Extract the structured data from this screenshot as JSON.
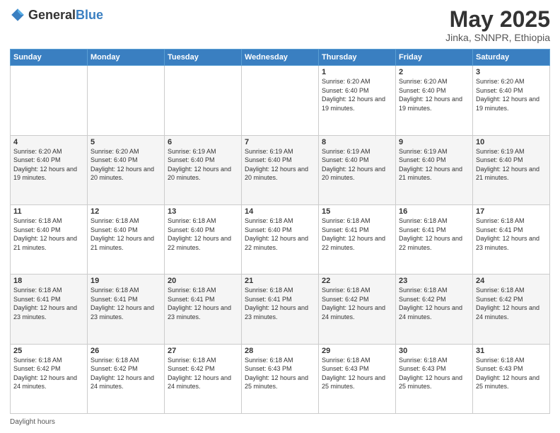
{
  "header": {
    "logo_general": "General",
    "logo_blue": "Blue",
    "month_title": "May 2025",
    "location": "Jinka, SNNPR, Ethiopia"
  },
  "days_of_week": [
    "Sunday",
    "Monday",
    "Tuesday",
    "Wednesday",
    "Thursday",
    "Friday",
    "Saturday"
  ],
  "footer_label": "Daylight hours",
  "weeks": [
    [
      {
        "day": "",
        "sunrise": "",
        "sunset": "",
        "daylight": ""
      },
      {
        "day": "",
        "sunrise": "",
        "sunset": "",
        "daylight": ""
      },
      {
        "day": "",
        "sunrise": "",
        "sunset": "",
        "daylight": ""
      },
      {
        "day": "",
        "sunrise": "",
        "sunset": "",
        "daylight": ""
      },
      {
        "day": "1",
        "sunrise": "Sunrise: 6:20 AM",
        "sunset": "Sunset: 6:40 PM",
        "daylight": "Daylight: 12 hours and 19 minutes."
      },
      {
        "day": "2",
        "sunrise": "Sunrise: 6:20 AM",
        "sunset": "Sunset: 6:40 PM",
        "daylight": "Daylight: 12 hours and 19 minutes."
      },
      {
        "day": "3",
        "sunrise": "Sunrise: 6:20 AM",
        "sunset": "Sunset: 6:40 PM",
        "daylight": "Daylight: 12 hours and 19 minutes."
      }
    ],
    [
      {
        "day": "4",
        "sunrise": "Sunrise: 6:20 AM",
        "sunset": "Sunset: 6:40 PM",
        "daylight": "Daylight: 12 hours and 19 minutes."
      },
      {
        "day": "5",
        "sunrise": "Sunrise: 6:20 AM",
        "sunset": "Sunset: 6:40 PM",
        "daylight": "Daylight: 12 hours and 20 minutes."
      },
      {
        "day": "6",
        "sunrise": "Sunrise: 6:19 AM",
        "sunset": "Sunset: 6:40 PM",
        "daylight": "Daylight: 12 hours and 20 minutes."
      },
      {
        "day": "7",
        "sunrise": "Sunrise: 6:19 AM",
        "sunset": "Sunset: 6:40 PM",
        "daylight": "Daylight: 12 hours and 20 minutes."
      },
      {
        "day": "8",
        "sunrise": "Sunrise: 6:19 AM",
        "sunset": "Sunset: 6:40 PM",
        "daylight": "Daylight: 12 hours and 20 minutes."
      },
      {
        "day": "9",
        "sunrise": "Sunrise: 6:19 AM",
        "sunset": "Sunset: 6:40 PM",
        "daylight": "Daylight: 12 hours and 21 minutes."
      },
      {
        "day": "10",
        "sunrise": "Sunrise: 6:19 AM",
        "sunset": "Sunset: 6:40 PM",
        "daylight": "Daylight: 12 hours and 21 minutes."
      }
    ],
    [
      {
        "day": "11",
        "sunrise": "Sunrise: 6:18 AM",
        "sunset": "Sunset: 6:40 PM",
        "daylight": "Daylight: 12 hours and 21 minutes."
      },
      {
        "day": "12",
        "sunrise": "Sunrise: 6:18 AM",
        "sunset": "Sunset: 6:40 PM",
        "daylight": "Daylight: 12 hours and 21 minutes."
      },
      {
        "day": "13",
        "sunrise": "Sunrise: 6:18 AM",
        "sunset": "Sunset: 6:40 PM",
        "daylight": "Daylight: 12 hours and 22 minutes."
      },
      {
        "day": "14",
        "sunrise": "Sunrise: 6:18 AM",
        "sunset": "Sunset: 6:40 PM",
        "daylight": "Daylight: 12 hours and 22 minutes."
      },
      {
        "day": "15",
        "sunrise": "Sunrise: 6:18 AM",
        "sunset": "Sunset: 6:41 PM",
        "daylight": "Daylight: 12 hours and 22 minutes."
      },
      {
        "day": "16",
        "sunrise": "Sunrise: 6:18 AM",
        "sunset": "Sunset: 6:41 PM",
        "daylight": "Daylight: 12 hours and 22 minutes."
      },
      {
        "day": "17",
        "sunrise": "Sunrise: 6:18 AM",
        "sunset": "Sunset: 6:41 PM",
        "daylight": "Daylight: 12 hours and 23 minutes."
      }
    ],
    [
      {
        "day": "18",
        "sunrise": "Sunrise: 6:18 AM",
        "sunset": "Sunset: 6:41 PM",
        "daylight": "Daylight: 12 hours and 23 minutes."
      },
      {
        "day": "19",
        "sunrise": "Sunrise: 6:18 AM",
        "sunset": "Sunset: 6:41 PM",
        "daylight": "Daylight: 12 hours and 23 minutes."
      },
      {
        "day": "20",
        "sunrise": "Sunrise: 6:18 AM",
        "sunset": "Sunset: 6:41 PM",
        "daylight": "Daylight: 12 hours and 23 minutes."
      },
      {
        "day": "21",
        "sunrise": "Sunrise: 6:18 AM",
        "sunset": "Sunset: 6:41 PM",
        "daylight": "Daylight: 12 hours and 23 minutes."
      },
      {
        "day": "22",
        "sunrise": "Sunrise: 6:18 AM",
        "sunset": "Sunset: 6:42 PM",
        "daylight": "Daylight: 12 hours and 24 minutes."
      },
      {
        "day": "23",
        "sunrise": "Sunrise: 6:18 AM",
        "sunset": "Sunset: 6:42 PM",
        "daylight": "Daylight: 12 hours and 24 minutes."
      },
      {
        "day": "24",
        "sunrise": "Sunrise: 6:18 AM",
        "sunset": "Sunset: 6:42 PM",
        "daylight": "Daylight: 12 hours and 24 minutes."
      }
    ],
    [
      {
        "day": "25",
        "sunrise": "Sunrise: 6:18 AM",
        "sunset": "Sunset: 6:42 PM",
        "daylight": "Daylight: 12 hours and 24 minutes."
      },
      {
        "day": "26",
        "sunrise": "Sunrise: 6:18 AM",
        "sunset": "Sunset: 6:42 PM",
        "daylight": "Daylight: 12 hours and 24 minutes."
      },
      {
        "day": "27",
        "sunrise": "Sunrise: 6:18 AM",
        "sunset": "Sunset: 6:42 PM",
        "daylight": "Daylight: 12 hours and 24 minutes."
      },
      {
        "day": "28",
        "sunrise": "Sunrise: 6:18 AM",
        "sunset": "Sunset: 6:43 PM",
        "daylight": "Daylight: 12 hours and 25 minutes."
      },
      {
        "day": "29",
        "sunrise": "Sunrise: 6:18 AM",
        "sunset": "Sunset: 6:43 PM",
        "daylight": "Daylight: 12 hours and 25 minutes."
      },
      {
        "day": "30",
        "sunrise": "Sunrise: 6:18 AM",
        "sunset": "Sunset: 6:43 PM",
        "daylight": "Daylight: 12 hours and 25 minutes."
      },
      {
        "day": "31",
        "sunrise": "Sunrise: 6:18 AM",
        "sunset": "Sunset: 6:43 PM",
        "daylight": "Daylight: 12 hours and 25 minutes."
      }
    ]
  ]
}
